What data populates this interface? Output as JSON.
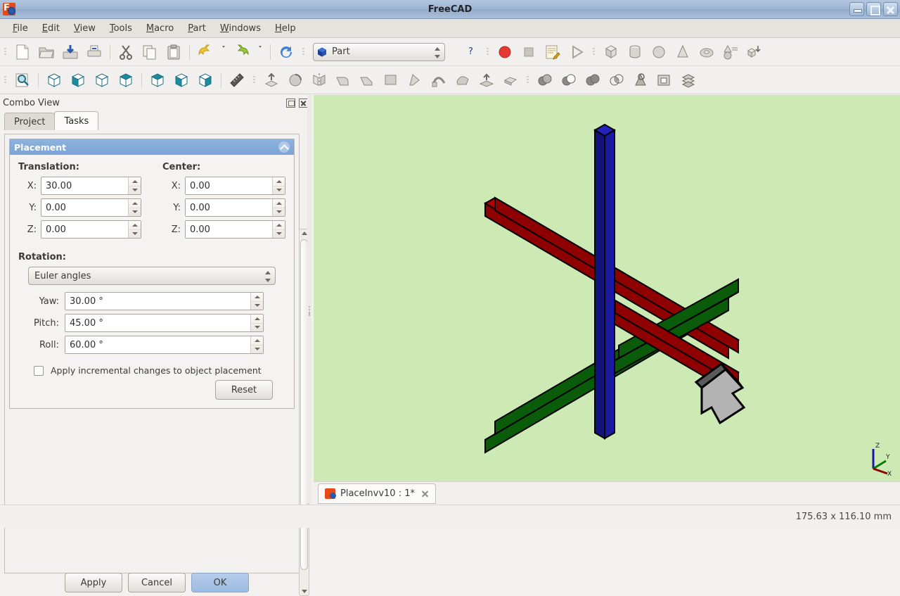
{
  "window": {
    "title": "FreeCAD",
    "app_icon": "freecad-icon",
    "controls": {
      "minimize": "minimize-button",
      "maximize": "maximize-button",
      "close": "close-button"
    }
  },
  "menubar": {
    "items": [
      {
        "label": "File",
        "mnemonic": "F"
      },
      {
        "label": "Edit",
        "mnemonic": "E"
      },
      {
        "label": "View",
        "mnemonic": "V"
      },
      {
        "label": "Tools",
        "mnemonic": "T"
      },
      {
        "label": "Macro",
        "mnemonic": "M"
      },
      {
        "label": "Part",
        "mnemonic": "P"
      },
      {
        "label": "Windows",
        "mnemonic": "W"
      },
      {
        "label": "Help",
        "mnemonic": "H"
      }
    ]
  },
  "toolbars": {
    "file": [
      "new-document-icon",
      "open-document-icon",
      "save-document-icon",
      "print-document-icon",
      "cut-icon",
      "copy-icon",
      "paste-icon",
      "undo-icon",
      "undo-dropdown-icon",
      "redo-icon",
      "redo-dropdown-icon",
      "refresh-icon"
    ],
    "workbench": {
      "selected": "Part",
      "icon": "part-workbench-icon"
    },
    "macro": [
      "whats-this-icon",
      "macro-record-icon",
      "macro-stop-icon",
      "macro-edit-icon",
      "macro-execute-icon"
    ],
    "primitives": [
      "box-icon",
      "cylinder-icon",
      "sphere-icon",
      "cone-icon",
      "torus-icon",
      "create-primitives-icon",
      "shape-builder-icon"
    ],
    "view": [
      "fit-all-icon",
      "axonometric-view-icon",
      "front-view-icon",
      "top-view-icon",
      "right-view-icon",
      "rear-view-icon",
      "bottom-view-icon",
      "left-view-icon",
      "measure-icon"
    ],
    "part": [
      "extrude-icon",
      "revolve-icon",
      "mirror-icon",
      "fillet-icon",
      "chamfer-icon",
      "ruled-surface-icon",
      "loft-icon",
      "sweep-icon",
      "section-icon",
      "cross-sections-icon",
      "offset-icon",
      "boolean-icon",
      "cut-shape-icon",
      "union-icon",
      "intersection-icon",
      "check-geometry-icon",
      "bounding-box-icon",
      "compound-icon"
    ]
  },
  "combo_view": {
    "title": "Combo View",
    "float_button": "float-panel-icon",
    "close_button": "close-panel-icon",
    "tabs": [
      {
        "label": "Project",
        "active": false
      },
      {
        "label": "Tasks",
        "active": true
      }
    ]
  },
  "placement": {
    "group_title": "Placement",
    "collapse_icon": "collapse-chevron-icon",
    "translation": {
      "label": "Translation:",
      "fields": [
        {
          "label": "X:",
          "value": "30.00"
        },
        {
          "label": "Y:",
          "value": "0.00"
        },
        {
          "label": "Z:",
          "value": "0.00"
        }
      ]
    },
    "center": {
      "label": "Center:",
      "fields": [
        {
          "label": "X:",
          "value": "0.00"
        },
        {
          "label": "Y:",
          "value": "0.00"
        },
        {
          "label": "Z:",
          "value": "0.00"
        }
      ]
    },
    "rotation": {
      "label": "Rotation:",
      "mode": "Euler angles",
      "angles": [
        {
          "label": "Yaw:",
          "value": "30.00 °"
        },
        {
          "label": "Pitch:",
          "value": "45.00 °"
        },
        {
          "label": "Roll:",
          "value": "60.00 °"
        }
      ]
    },
    "incremental": {
      "label": "Apply incremental changes to object placement",
      "checked": false
    },
    "reset_label": "Reset",
    "buttons": [
      {
        "label": "Apply",
        "primary": false
      },
      {
        "label": "Cancel",
        "primary": false
      },
      {
        "label": "OK",
        "primary": true
      }
    ]
  },
  "view3d": {
    "background": "#cdeab4",
    "axis_bars": [
      {
        "name": "x-axis-bar",
        "color": "#b00000"
      },
      {
        "name": "y-axis-bar",
        "color": "#067006"
      },
      {
        "name": "z-axis-bar",
        "color": "#14148c"
      }
    ],
    "arrow": {
      "name": "placement-arrow",
      "color": "#b3b3b3"
    },
    "axis_cross": {
      "x": "X",
      "y": "Y",
      "z": "Z"
    }
  },
  "document_tab": {
    "label": "PlaceInvv10 : 1*",
    "icon": "freecad-document-icon",
    "close": "close-tab-icon"
  },
  "statusbar": {
    "dimensions": "175.63 x 116.10 mm"
  }
}
